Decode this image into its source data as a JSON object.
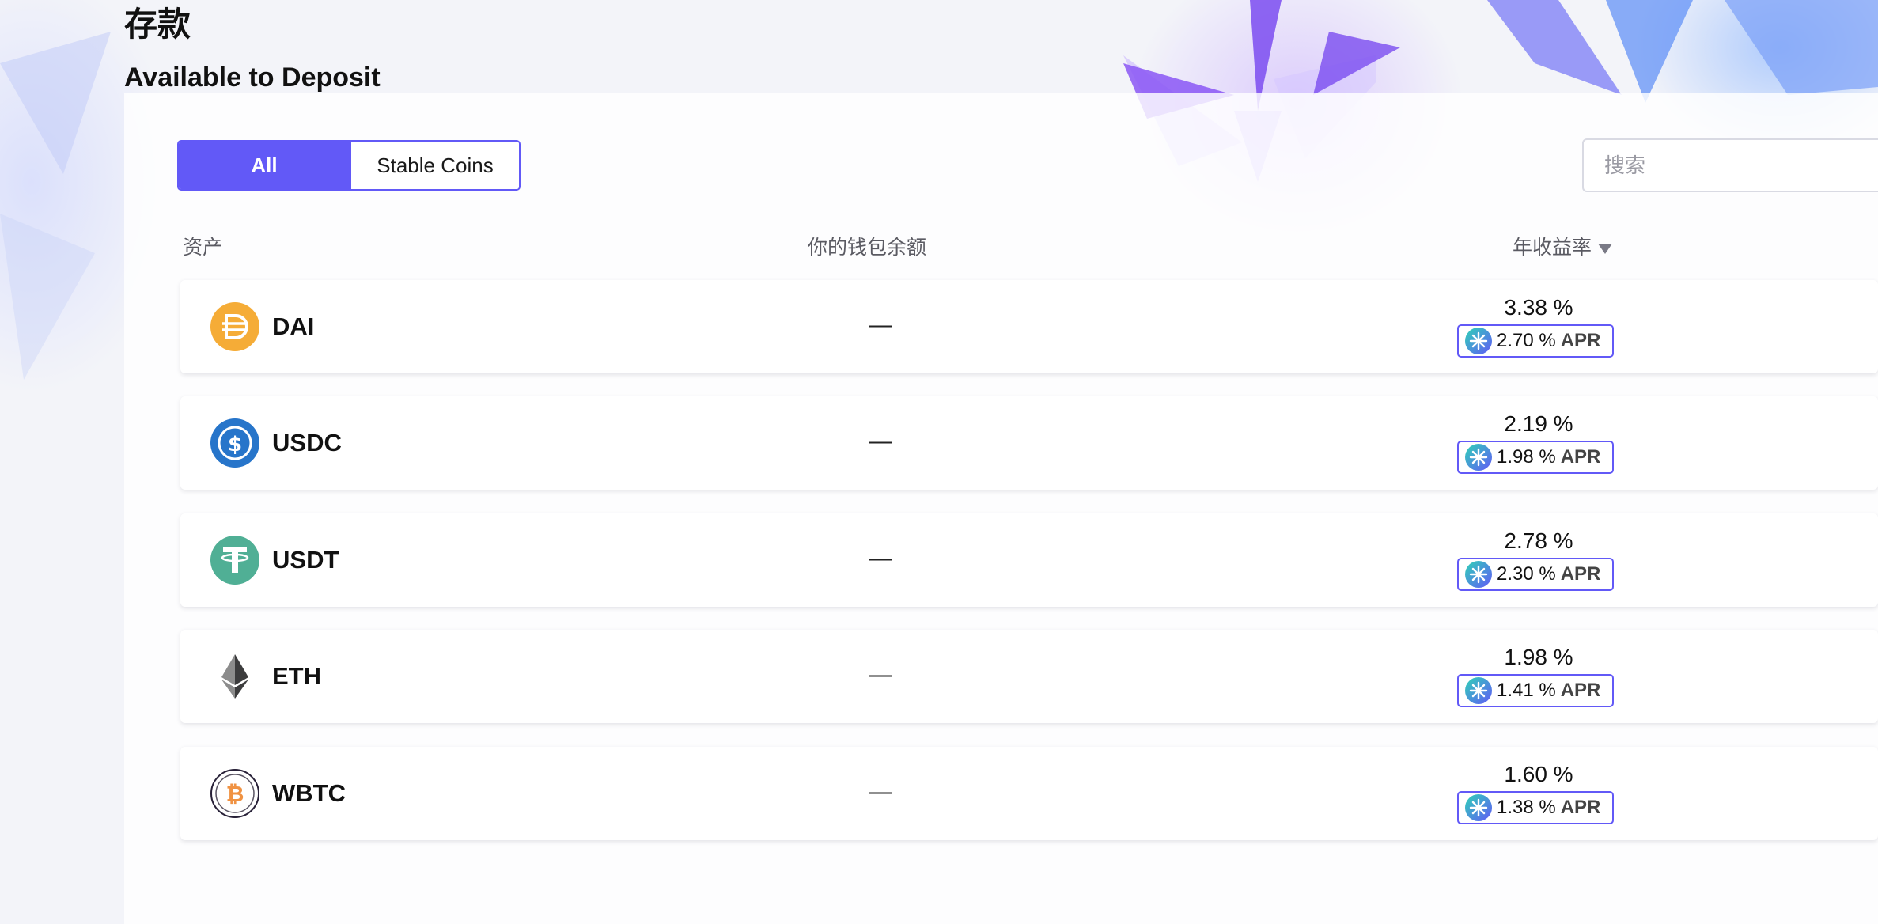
{
  "header": {
    "title": "存款",
    "subtitle": "Available to Deposit"
  },
  "filters": {
    "all_label": "All",
    "stable_label": "Stable Coins",
    "selected": "All"
  },
  "search": {
    "placeholder": "搜索",
    "value": ""
  },
  "table": {
    "columns": {
      "asset": "资产",
      "balance": "你的钱包余额",
      "apy": "年收益率"
    },
    "rows": [
      {
        "symbol": "DAI",
        "balance": "—",
        "apy": "3.38 %",
        "apr_value": "2.70 %",
        "apr_label": "APR",
        "icon": "dai-icon"
      },
      {
        "symbol": "USDC",
        "balance": "—",
        "apy": "2.19 %",
        "apr_value": "1.98 %",
        "apr_label": "APR",
        "icon": "usdc-icon"
      },
      {
        "symbol": "USDT",
        "balance": "—",
        "apy": "2.78 %",
        "apr_value": "2.30 %",
        "apr_label": "APR",
        "icon": "usdt-icon"
      },
      {
        "symbol": "ETH",
        "balance": "—",
        "apy": "1.98 %",
        "apr_value": "1.41 %",
        "apr_label": "APR",
        "icon": "eth-icon"
      },
      {
        "symbol": "WBTC",
        "balance": "—",
        "apy": "1.60 %",
        "apr_value": "1.38 %",
        "apr_label": "APR",
        "icon": "wbtc-icon"
      }
    ]
  },
  "colors": {
    "accent": "#6259f7",
    "dai": "#f5ac37",
    "usdc": "#2775ca",
    "usdt": "#50af95",
    "wbtc": "#f09242"
  }
}
